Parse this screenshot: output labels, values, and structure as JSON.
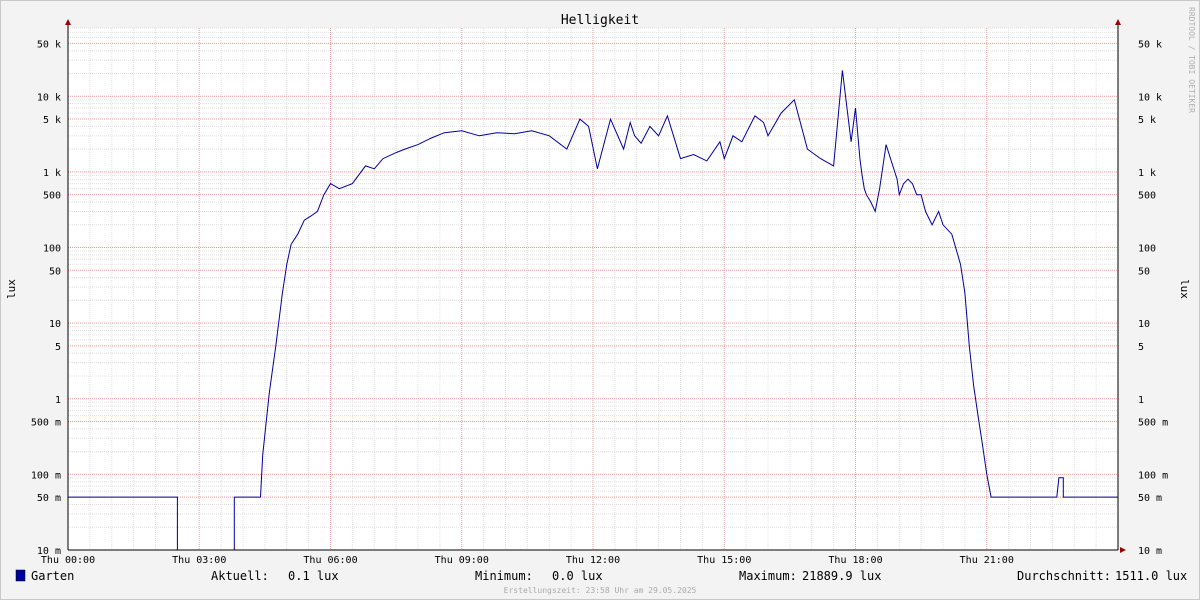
{
  "chart_data": {
    "type": "line",
    "title": "Helligkeit",
    "ylabel": "lux",
    "yscale": "log",
    "ylim": [
      0.01,
      80000
    ],
    "xlim": [
      0,
      24
    ],
    "x_ticks": [
      {
        "value": 0,
        "label": "Thu 00:00"
      },
      {
        "value": 3,
        "label": "Thu 03:00"
      },
      {
        "value": 6,
        "label": "Thu 06:00"
      },
      {
        "value": 9,
        "label": "Thu 09:00"
      },
      {
        "value": 12,
        "label": "Thu 12:00"
      },
      {
        "value": 15,
        "label": "Thu 15:00"
      },
      {
        "value": 18,
        "label": "Thu 18:00"
      },
      {
        "value": 21,
        "label": "Thu 21:00"
      }
    ],
    "y_ticks": [
      {
        "value": 0.01,
        "label": "10 m"
      },
      {
        "value": 0.05,
        "label": "50 m"
      },
      {
        "value": 0.1,
        "label": "100 m"
      },
      {
        "value": 0.5,
        "label": "500 m"
      },
      {
        "value": 1,
        "label": "1"
      },
      {
        "value": 5,
        "label": "5"
      },
      {
        "value": 10,
        "label": "10"
      },
      {
        "value": 50,
        "label": "50"
      },
      {
        "value": 100,
        "label": "100"
      },
      {
        "value": 500,
        "label": "500"
      },
      {
        "value": 1000,
        "label": "1 k"
      },
      {
        "value": 5000,
        "label": "5 k"
      },
      {
        "value": 10000,
        "label": "10 k"
      },
      {
        "value": 50000,
        "label": "50 k"
      }
    ],
    "grid": true,
    "series": [
      {
        "name": "Garten",
        "color": "#0000a0",
        "x": [
          0,
          2.5,
          2.5,
          3.8,
          3.8,
          4.4,
          4.45,
          4.6,
          4.75,
          4.9,
          5.0,
          5.1,
          5.25,
          5.4,
          5.55,
          5.7,
          5.85,
          6.0,
          6.2,
          6.5,
          6.8,
          7.0,
          7.2,
          7.5,
          7.7,
          8.0,
          8.3,
          8.6,
          9.0,
          9.4,
          9.8,
          10.2,
          10.6,
          11.0,
          11.4,
          11.7,
          11.9,
          12.1,
          12.4,
          12.7,
          12.85,
          12.95,
          13.1,
          13.3,
          13.5,
          13.7,
          14.0,
          14.3,
          14.6,
          14.9,
          15.0,
          15.2,
          15.4,
          15.7,
          15.9,
          16.0,
          16.3,
          16.6,
          16.9,
          17.2,
          17.5,
          17.7,
          17.9,
          18.0,
          18.1,
          18.15,
          18.2,
          18.25,
          18.35,
          18.45,
          18.55,
          18.7,
          18.8,
          18.95,
          19.0,
          19.1,
          19.2,
          19.3,
          19.4,
          19.5,
          19.6,
          19.75,
          19.9,
          20.0,
          20.2,
          20.4,
          20.5,
          20.6,
          20.7,
          20.8,
          20.9,
          21.0,
          21.1,
          21.2,
          21.3,
          21.4,
          21.5,
          21.6,
          21.7,
          21.8,
          21.9,
          22.0,
          22.1,
          22.2,
          22.35,
          22.6,
          22.65,
          22.75,
          22.75,
          24.0
        ],
        "values": [
          0.05,
          0.05,
          0.01,
          0.01,
          0.05,
          0.05,
          0.18,
          1.2,
          5,
          25,
          60,
          110,
          150,
          230,
          260,
          300,
          500,
          700,
          600,
          700,
          1200,
          1100,
          1500,
          1800,
          2000,
          2300,
          2800,
          3300,
          3500,
          3000,
          3300,
          3200,
          3500,
          3000,
          2000,
          5000,
          4000,
          1100,
          5000,
          2000,
          4500,
          3000,
          2400,
          4000,
          3000,
          5500,
          1500,
          1700,
          1400,
          2500,
          1500,
          3000,
          2500,
          5500,
          4500,
          3000,
          6000,
          9000,
          2000,
          1500,
          1200,
          22000,
          2500,
          7000,
          1500,
          900,
          600,
          500,
          400,
          300,
          600,
          2300,
          1500,
          800,
          500,
          700,
          800,
          700,
          500,
          500,
          300,
          200,
          300,
          200,
          150,
          60,
          25,
          5,
          1.5,
          0.6,
          0.25,
          0.1,
          0.05,
          0.05,
          0.05,
          0.05,
          0.05,
          0.05,
          0.05,
          0.05,
          0.05,
          0.05,
          0.05,
          0.05,
          0.05,
          0.05,
          0.09,
          0.09,
          0.05,
          0.05
        ]
      }
    ]
  },
  "legend": {
    "swatch_color": "#0000a0",
    "series_label": "Garten",
    "current_label": "Aktuell:",
    "current_value": "0.1 lux",
    "min_label": "Minimum:",
    "min_value": "0.0 lux",
    "max_label": "Maximum:",
    "max_value": "21889.9 lux",
    "avg_label": "Durchschnitt:",
    "avg_value": "1511.0 lux"
  },
  "footer": "Erstellungszeit: 23:58 Uhr am 29.05.2025",
  "watermark": "RRDTOOL / TOBI OETIKER"
}
